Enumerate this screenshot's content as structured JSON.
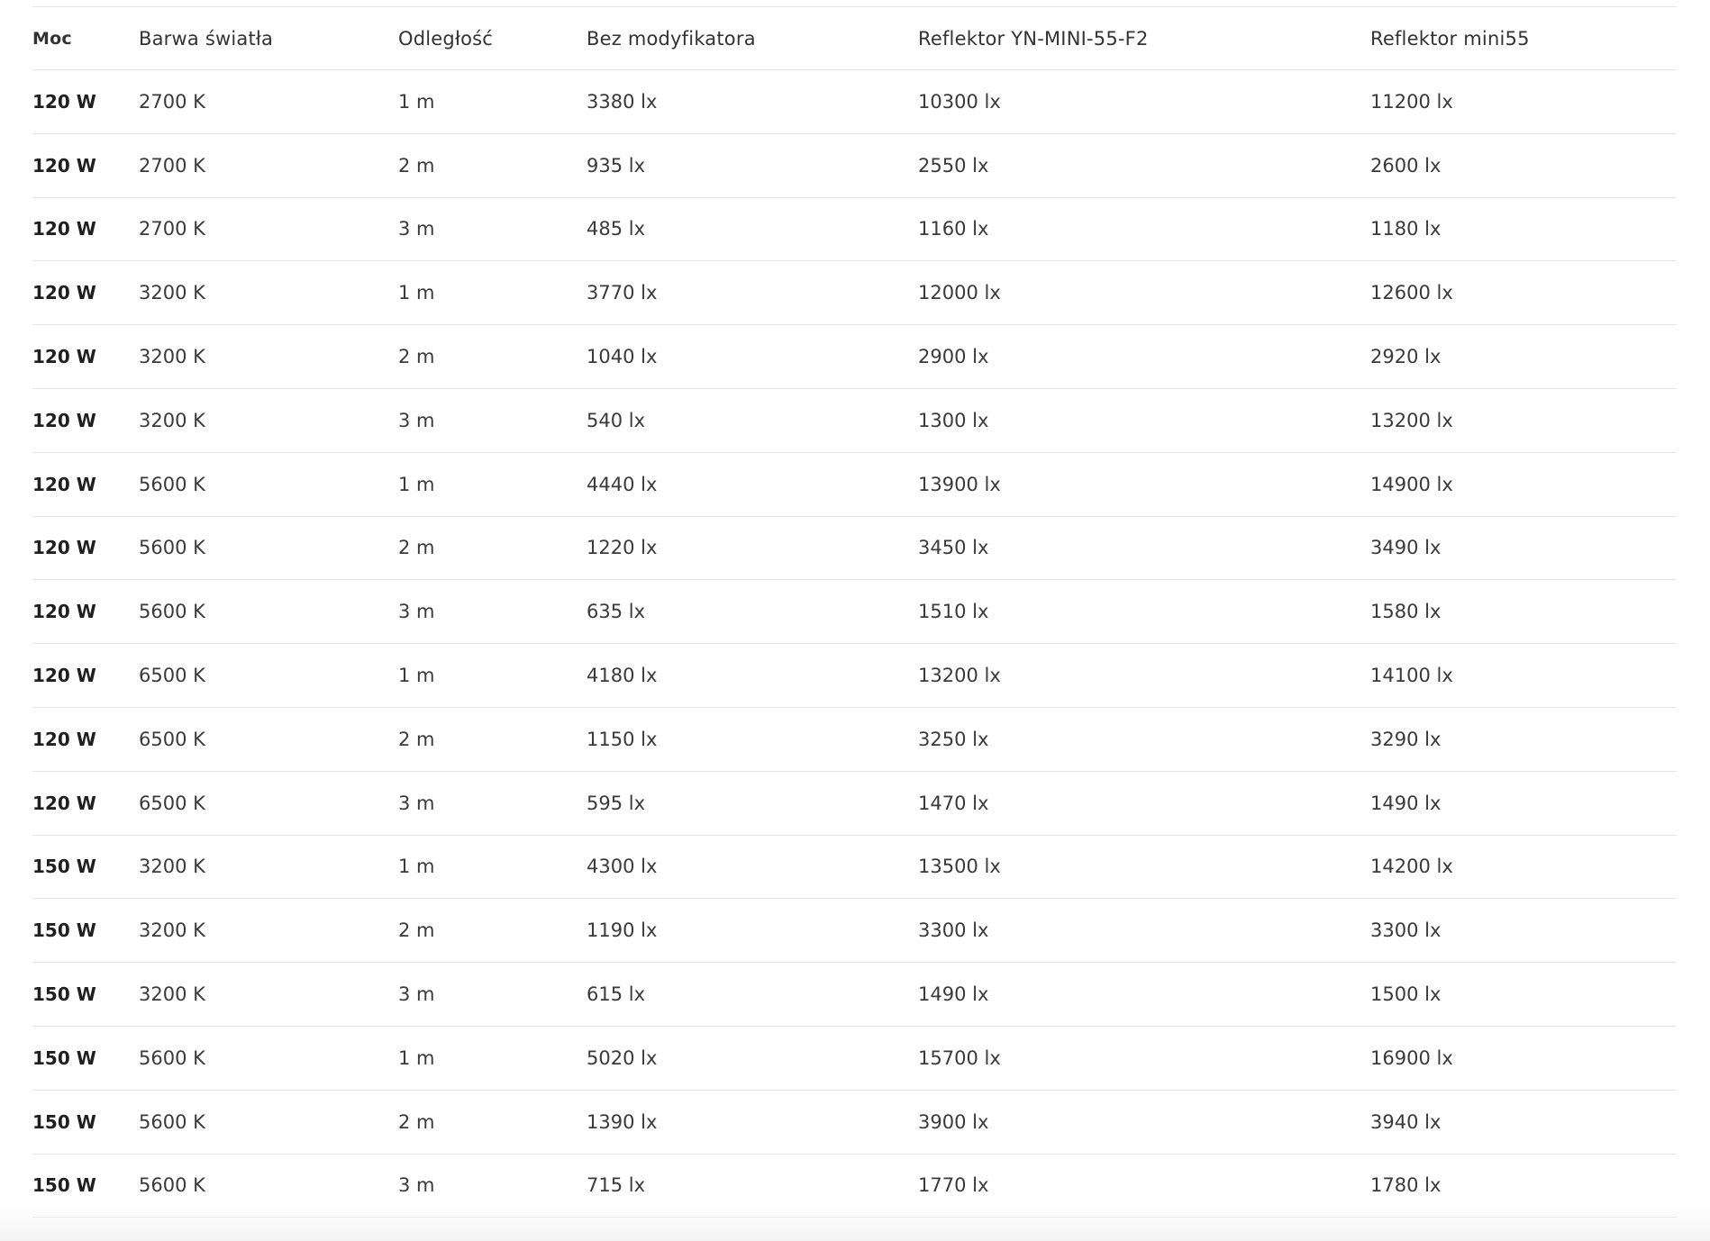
{
  "table": {
    "headers": [
      "Moc",
      "Barwa światła",
      "Odległość",
      "Bez modyfikatora",
      "Reflektor YN-MINI-55-F2",
      "Reflektor mini55"
    ],
    "rows": [
      [
        "120 W",
        "2700 K",
        "1 m",
        "3380 lx",
        "10300 lx",
        "11200 lx"
      ],
      [
        "120 W",
        "2700 K",
        "2 m",
        "935 lx",
        "2550 lx",
        "2600 lx"
      ],
      [
        "120 W",
        "2700 K",
        "3 m",
        "485 lx",
        "1160 lx",
        "1180 lx"
      ],
      [
        "120 W",
        "3200 K",
        "1 m",
        "3770 lx",
        "12000 lx",
        "12600 lx"
      ],
      [
        "120 W",
        "3200 K",
        "2 m",
        "1040 lx",
        "2900 lx",
        "2920 lx"
      ],
      [
        "120 W",
        "3200 K",
        "3 m",
        "540 lx",
        "1300 lx",
        "13200 lx"
      ],
      [
        "120 W",
        "5600 K",
        "1 m",
        "4440 lx",
        "13900 lx",
        "14900 lx"
      ],
      [
        "120 W",
        "5600 K",
        "2 m",
        "1220 lx",
        "3450 lx",
        "3490 lx"
      ],
      [
        "120 W",
        "5600 K",
        "3 m",
        "635 lx",
        "1510 lx",
        "1580 lx"
      ],
      [
        "120 W",
        "6500 K",
        "1 m",
        "4180 lx",
        "13200 lx",
        "14100 lx"
      ],
      [
        "120 W",
        "6500 K",
        "2 m",
        "1150 lx",
        "3250 lx",
        "3290 lx"
      ],
      [
        "120 W",
        "6500 K",
        "3 m",
        "595 lx",
        "1470 lx",
        "1490 lx"
      ],
      [
        "150 W",
        "3200 K",
        "1 m",
        "4300 lx",
        "13500 lx",
        "14200 lx"
      ],
      [
        "150 W",
        "3200 K",
        "2 m",
        "1190 lx",
        "3300 lx",
        "3300 lx"
      ],
      [
        "150 W",
        "3200 K",
        "3 m",
        "615 lx",
        "1490 lx",
        "1500 lx"
      ],
      [
        "150 W",
        "5600 K",
        "1 m",
        "5020 lx",
        "15700 lx",
        "16900 lx"
      ],
      [
        "150 W",
        "5600 K",
        "2 m",
        "1390 lx",
        "3900 lx",
        "3940 lx"
      ],
      [
        "150 W",
        "5600 K",
        "3 m",
        "715 lx",
        "1770 lx",
        "1780 lx"
      ]
    ]
  },
  "colors": {
    "text": "#2b2b2b",
    "divider": "#e6e6e6",
    "background": "#ffffff"
  }
}
